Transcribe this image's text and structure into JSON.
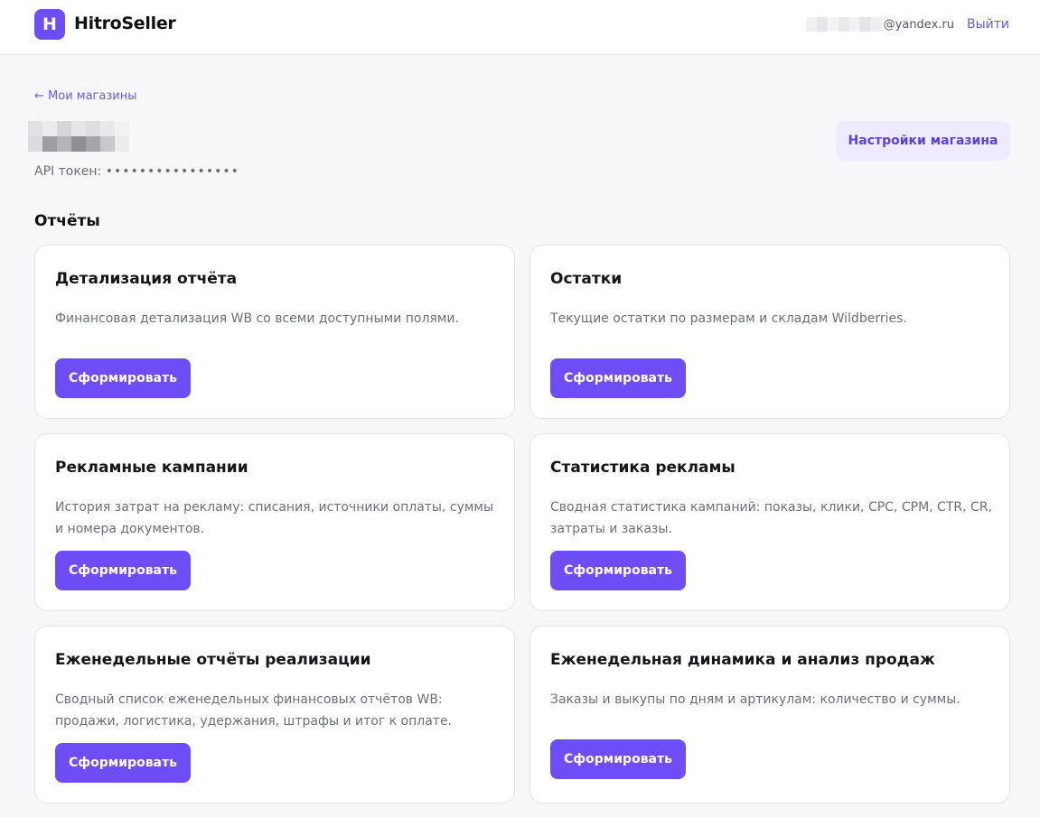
{
  "header": {
    "logo_letter": "H",
    "brand": "HitroSeller",
    "email_domain": "@yandex.ru",
    "logout": "Выйти"
  },
  "nav": {
    "back": "← Мои магазины"
  },
  "store": {
    "api_label": "API токен:",
    "api_value": "••••••••••••••••",
    "settings_button": "Настройки магазина"
  },
  "reports": {
    "title": "Отчёты",
    "cards": [
      {
        "title": "Детализация отчёта",
        "desc": [
          "Финансовая детализация WB со всеми доступными полями."
        ],
        "button": "Сформировать"
      },
      {
        "title": "Остатки",
        "desc": [
          "Текущие остатки по размерам и складам Wildberries."
        ],
        "button": "Сформировать"
      },
      {
        "title": "Рекламные кампании",
        "desc": [
          "История затрат на рекламу: списания, источники оплаты, суммы",
          "и номера документов."
        ],
        "button": "Сформировать"
      },
      {
        "title": "Статистика рекламы",
        "desc": [
          "Сводная статистика кампаний: показы, клики, CPC, CPM, CTR, CR,",
          "затраты и заказы."
        ],
        "button": "Сформировать"
      },
      {
        "title": "Еженедельные отчёты реализации",
        "desc": [
          "Сводный список еженедельных финансовых отчётов WB:",
          "продажи, логистика, удержания, штрафы и итог к оплате."
        ],
        "button": "Сформировать"
      },
      {
        "title": "Еженедельная динамика и анализ продаж",
        "desc": [
          "Заказы и выкупы по дням и артикулам: количество и суммы."
        ],
        "button": "Сформировать"
      }
    ]
  },
  "colors": {
    "accent": "#6d4ef6",
    "accent_soft": "#efebfd",
    "link": "#6a5ae0",
    "background": "#f7f7fa"
  }
}
